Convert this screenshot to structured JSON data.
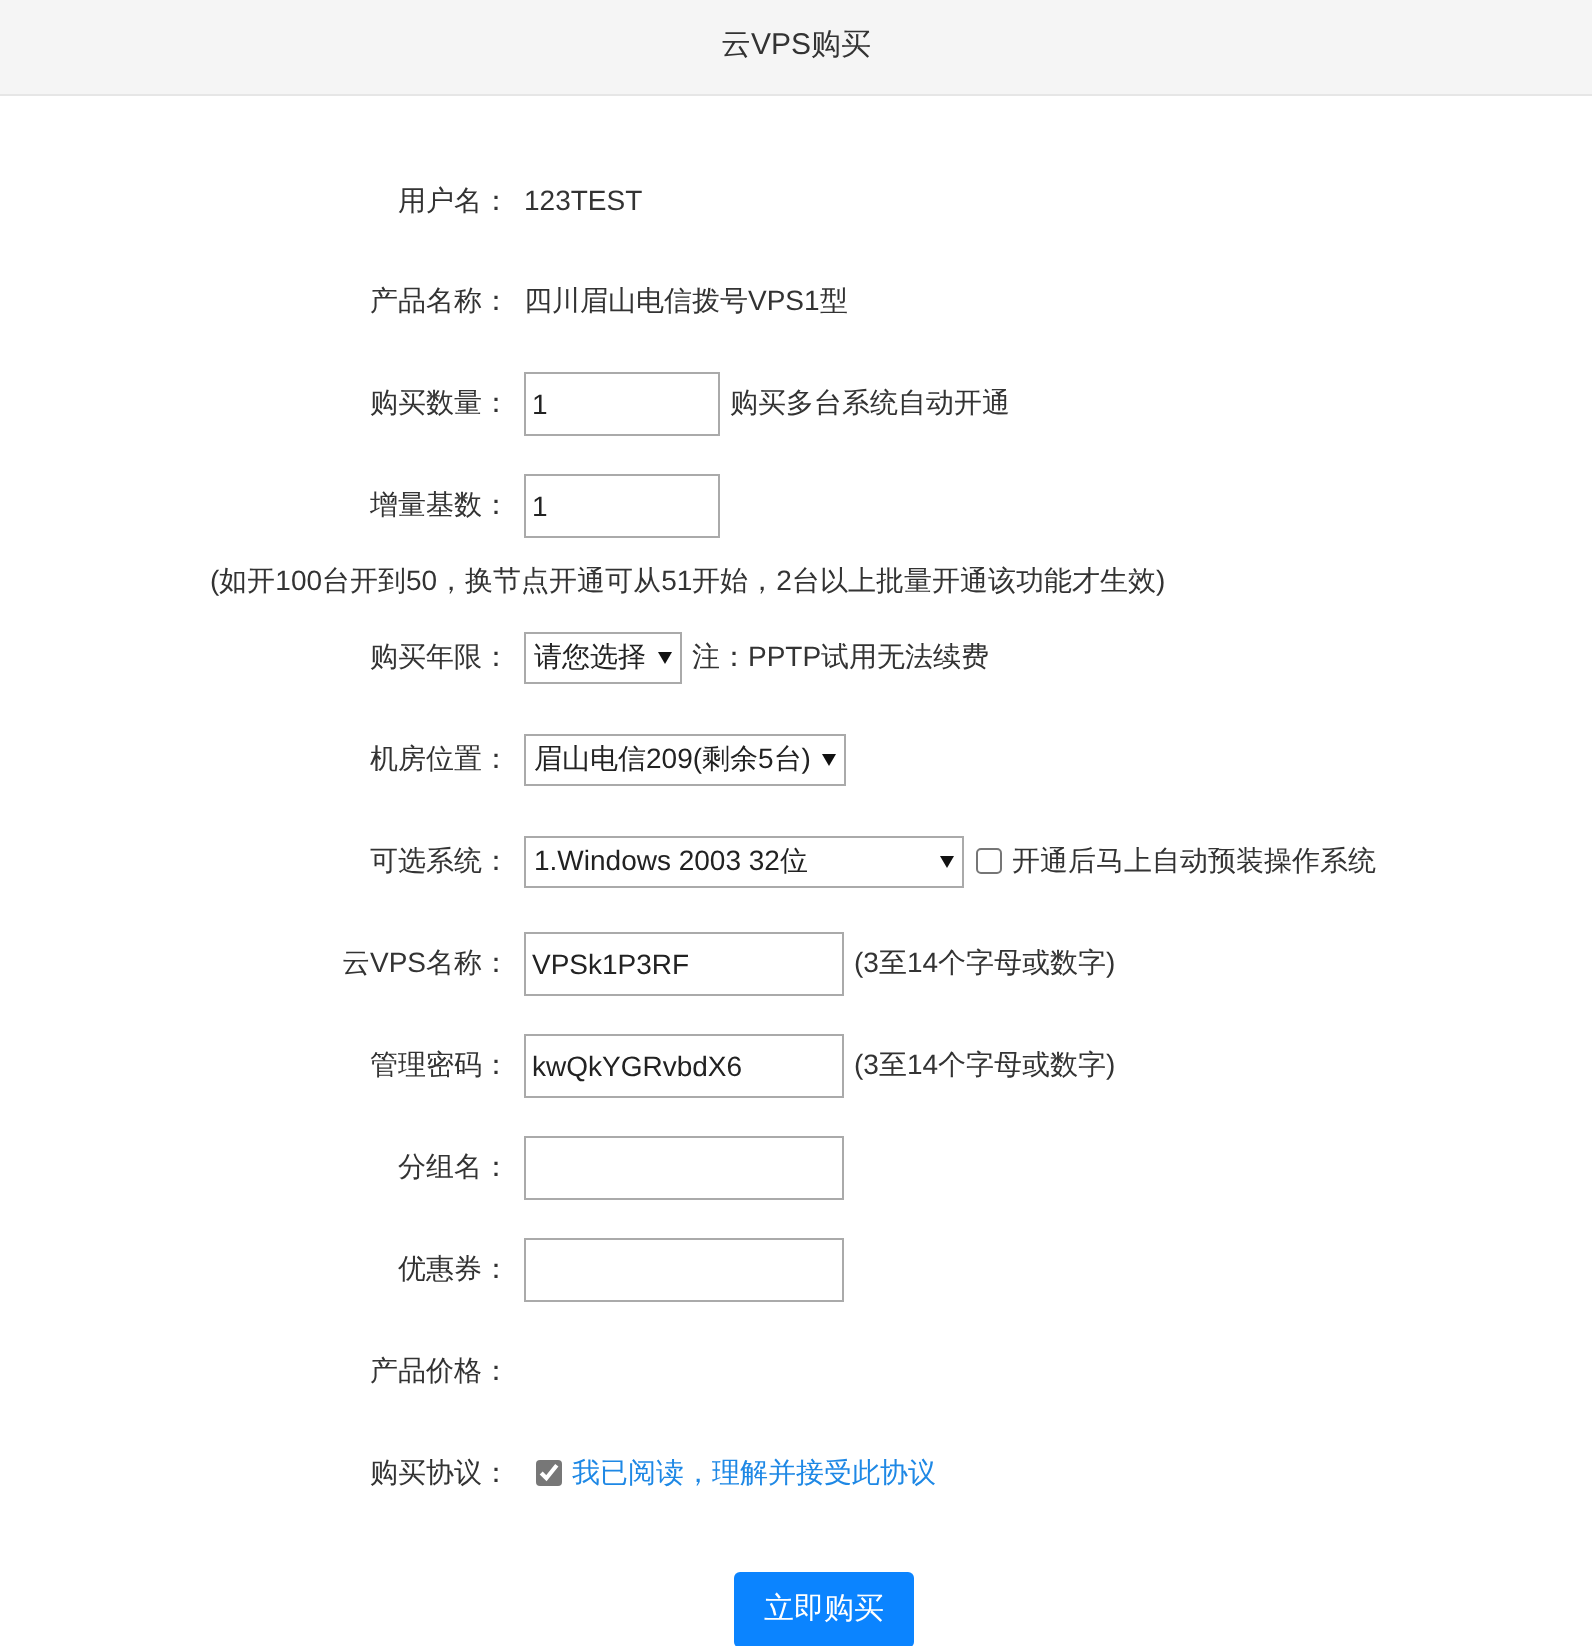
{
  "header": {
    "title": "云VPS购买"
  },
  "rows": [
    {
      "kind": "text",
      "label": "用户名：",
      "value": "123TEST"
    },
    {
      "kind": "text",
      "label": "产品名称：",
      "value": "四川眉山电信拨号VPS1型"
    },
    {
      "kind": "input",
      "label": "购买数量：",
      "value": "1",
      "short": true,
      "note": "购买多台系统自动开通"
    },
    {
      "kind": "input",
      "label": "增量基数：",
      "value": "1",
      "short": true,
      "hint": "(如开100台开到50，换节点开通可从51开始，2台以上批量开通该功能才生效)"
    },
    {
      "kind": "select",
      "label": "购买年限：",
      "value": "请您选择",
      "note": "注：PPTP试用无法续费"
    },
    {
      "kind": "select",
      "label": "机房位置：",
      "value": "眉山电信209(剩余5台)"
    },
    {
      "kind": "select",
      "label": "可选系统：",
      "value": "1.Windows 2003 32位",
      "wide": true,
      "checkbox": {
        "label": "开通后马上自动预装操作系统",
        "checked": false
      }
    },
    {
      "kind": "input",
      "label": "云VPS名称：",
      "value": "VPSk1P3RF",
      "note": "(3至14个字母或数字)"
    },
    {
      "kind": "input",
      "label": "管理密码：",
      "value": "kwQkYGRvbdX6",
      "note": "(3至14个字母或数字)"
    },
    {
      "kind": "input",
      "label": "分组名："
    },
    {
      "kind": "input",
      "label": "优惠券："
    },
    {
      "kind": "text",
      "label": "产品价格："
    },
    {
      "kind": "agreement",
      "label": "购买协议：",
      "checked": true,
      "link": "我已阅读，理解并接受此协议"
    }
  ],
  "submit": {
    "label": "立即购买"
  }
}
